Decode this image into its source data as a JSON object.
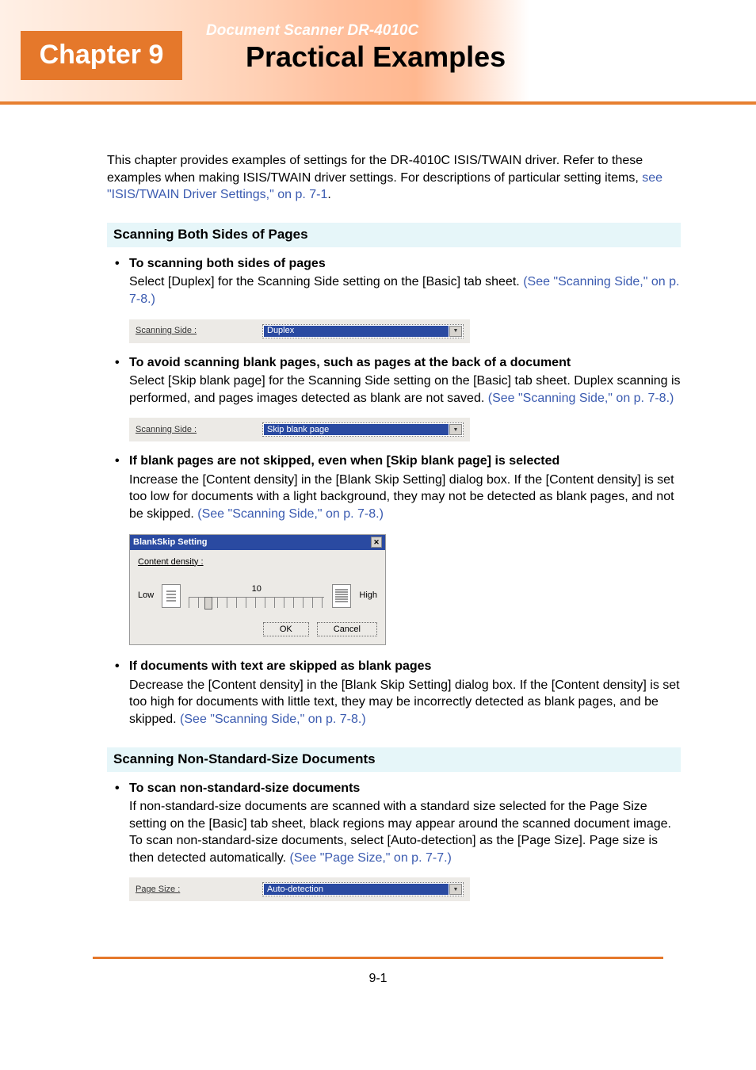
{
  "header": {
    "doc_title": "Document Scanner DR-4010C",
    "chapter_label": "Chapter 9",
    "chapter_title": "Practical Examples"
  },
  "intro": {
    "text_a": "This chapter provides examples of settings for the DR-4010C ISIS/TWAIN driver. Refer to these examples when making ISIS/TWAIN driver settings. For descriptions of particular setting items, ",
    "link": "see \"ISIS/TWAIN Driver Settings,\" on p. 7-1",
    "text_b": "."
  },
  "sections": [
    {
      "heading": "Scanning Both Sides of Pages",
      "items": [
        {
          "title": "To scanning both sides of pages",
          "body": "Select [Duplex] for the Scanning Side setting on the [Basic] tab sheet. ",
          "link": "(See \"Scanning Side,\" on p. 7-8.)",
          "ui": {
            "type": "row",
            "label": "Scanning Side :",
            "value": "Duplex"
          }
        },
        {
          "title": "To avoid scanning blank pages, such as pages at the back of a document",
          "body": "Select [Skip blank page] for the Scanning Side setting on the [Basic] tab sheet. Duplex scanning is performed, and pages images detected as blank are not saved. ",
          "link": "(See \"Scanning Side,\" on p. 7-8.)",
          "ui": {
            "type": "row",
            "label": "Scanning Side :",
            "value": "Skip blank page"
          }
        },
        {
          "title": "If blank pages are not skipped, even when [Skip blank page] is selected",
          "body": "Increase the [Content density] in the [Blank Skip Setting] dialog box. If the [Content density] is set too low for documents with a light background, they may not be detected as blank pages, and not be skipped. ",
          "link": "(See \"Scanning Side,\" on p. 7-8.)",
          "ui": {
            "type": "dialog",
            "title": "BlankSkip Setting",
            "content_label": "Content density :",
            "low": "Low",
            "high": "High",
            "slider_value": "10",
            "ok": "OK",
            "cancel": "Cancel"
          }
        },
        {
          "title": "If documents with text are skipped as blank pages",
          "body": "Decrease the [Content density] in the [Blank Skip Setting] dialog box. If the [Content density] is set too high for documents with little text, they may be incorrectly detected as blank pages, and be skipped. ",
          "link": "(See \"Scanning Side,\" on p. 7-8.)"
        }
      ]
    },
    {
      "heading": "Scanning Non-Standard-Size Documents",
      "items": [
        {
          "title": "To scan non-standard-size documents",
          "body": "If non-standard-size documents are scanned with a standard size selected for the Page Size setting on the [Basic] tab sheet, black regions may appear around the scanned document image. To scan non-standard-size documents, select [Auto-detection] as the [Page Size]. Page size is then detected automatically. ",
          "link": "(See \"Page Size,\" on p. 7-7.)",
          "ui": {
            "type": "row",
            "label": "Page Size :",
            "value": "Auto-detection"
          }
        }
      ]
    }
  ],
  "footer": {
    "page_number": "9-1"
  }
}
